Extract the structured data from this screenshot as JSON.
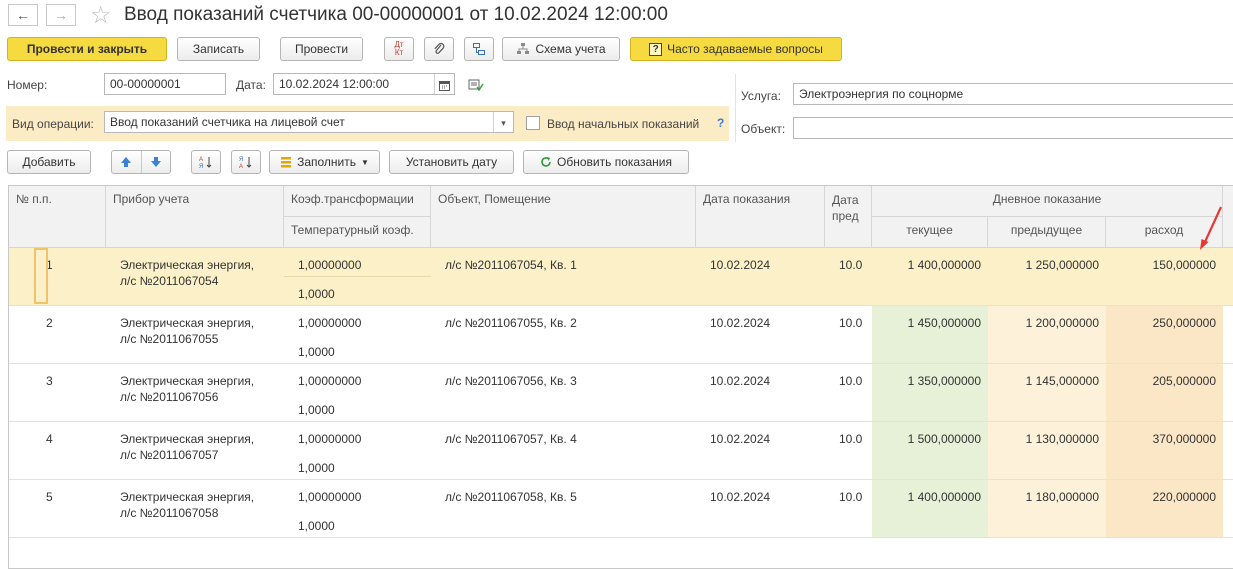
{
  "window": {
    "title": "Ввод показаний счетчика 00-00000001 от 10.02.2024 12:00:00",
    "back_glyph": "←",
    "forward_glyph": "→",
    "favorite_glyph": "☆"
  },
  "toolbar": {
    "post_close": "Провести и закрыть",
    "save": "Записать",
    "post": "Провести",
    "dt_kt_top": "Дт",
    "dt_kt_bottom": "Кт",
    "scheme": "Схема учета",
    "faq_mark": "?",
    "faq": "Часто задаваемые вопросы"
  },
  "header": {
    "number_label": "Номер:",
    "number_value": "00-00000001",
    "date_label": "Дата:",
    "date_value": "10.02.2024 12:00:00",
    "service_label": "Услуга:",
    "service_value": "Электроэнергия по соцнорме",
    "object_label": "Объект:",
    "object_value": "",
    "operation_label": "Вид операции:",
    "operation_value": "Ввод показаний счетчика на лицевой счет",
    "initial_readings_label": "Ввод начальных показаний",
    "help_mark": "?"
  },
  "table_toolbar": {
    "add": "Добавить",
    "fill": "Заполнить",
    "set_date": "Установить дату",
    "refresh": "Обновить показания"
  },
  "table": {
    "headers": {
      "num": "№ п.п.",
      "device": "Прибор учета",
      "coef": "Коэф.трансформации",
      "temp_coef": "Температурный коэф.",
      "object": "Объект, Помещение",
      "date": "Дата показания",
      "date_prev_1": "Дата",
      "date_prev_2": "пред",
      "day_group": "Дневное показание",
      "current": "текущее",
      "previous": "предыдущее",
      "consumption": "расход"
    },
    "rows": [
      {
        "num": "1",
        "device_1": "Электрическая энергия,",
        "device_2": "л/с №2011067054",
        "coef": "1,00000000",
        "temp": "1,0000",
        "object": "л/с №2011067054, Кв. 1",
        "date": "10.02.2024",
        "prev": "10.0",
        "current": "1 400,000000",
        "previous": "1 250,000000",
        "consumption": "150,000000"
      },
      {
        "num": "2",
        "device_1": "Электрическая энергия,",
        "device_2": "л/с №2011067055",
        "coef": "1,00000000",
        "temp": "1,0000",
        "object": "л/с №2011067055, Кв. 2",
        "date": "10.02.2024",
        "prev": "10.0",
        "current": "1 450,000000",
        "previous": "1 200,000000",
        "consumption": "250,000000"
      },
      {
        "num": "3",
        "device_1": "Электрическая энергия,",
        "device_2": "л/с №2011067056",
        "coef": "1,00000000",
        "temp": "1,0000",
        "object": "л/с №2011067056, Кв. 3",
        "date": "10.02.2024",
        "prev": "10.0",
        "current": "1 350,000000",
        "previous": "1 145,000000",
        "consumption": "205,000000"
      },
      {
        "num": "4",
        "device_1": "Электрическая энергия,",
        "device_2": "л/с №2011067057",
        "coef": "1,00000000",
        "temp": "1,0000",
        "object": "л/с №2011067057, Кв. 4",
        "date": "10.02.2024",
        "prev": "10.0",
        "current": "1 500,000000",
        "previous": "1 130,000000",
        "consumption": "370,000000"
      },
      {
        "num": "5",
        "device_1": "Электрическая энергия,",
        "device_2": "л/с №2011067058",
        "coef": "1,00000000",
        "temp": "1,0000",
        "object": "л/с №2011067058, Кв. 5",
        "date": "10.02.2024",
        "prev": "10.0",
        "current": "1 400,000000",
        "previous": "1 180,000000",
        "consumption": "220,000000"
      }
    ]
  },
  "colors": {
    "accent_yellow": "#f5da40",
    "operation_band": "#fbecc6",
    "selected_row": "#fbf0c8",
    "current_col": "#e6f1d8",
    "previous_col": "#fdf2d9",
    "consumption_col": "#fbe6c6",
    "annotation_arrow": "#e53935"
  }
}
